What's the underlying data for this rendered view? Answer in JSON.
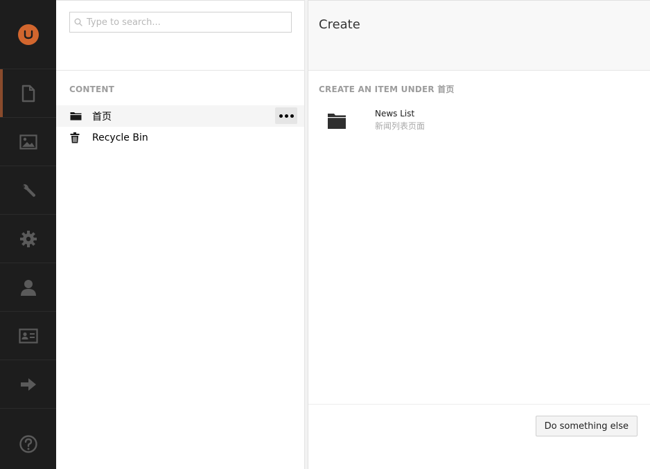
{
  "colors": {
    "appbar_bg": "#1d1d1d",
    "logo": "#d2662e",
    "active_marker": "#8a4b2c",
    "icon_dim": "#5a5a5a"
  },
  "appbar": {
    "logo": "umbraco-logo-icon",
    "sections": [
      {
        "icon": "content-document-icon",
        "active": true
      },
      {
        "icon": "media-image-icon",
        "active": false
      },
      {
        "icon": "settings-wrench-icon",
        "active": false
      },
      {
        "icon": "developer-gear-icon",
        "active": false
      },
      {
        "icon": "users-person-icon",
        "active": false
      },
      {
        "icon": "members-id-card-icon",
        "active": false
      },
      {
        "icon": "forms-arrow-right-icon",
        "active": false
      }
    ],
    "help_icon": "help-circle-icon"
  },
  "tree": {
    "search": {
      "placeholder": "Type to search...",
      "value": ""
    },
    "section_label": "CONTENT",
    "items": [
      {
        "label": "首页",
        "icon": "folder-icon",
        "hovered": true
      },
      {
        "label": "Recycle Bin",
        "icon": "trash-icon",
        "hovered": false
      }
    ]
  },
  "create": {
    "title": "Create",
    "subtitle": "CREATE AN ITEM UNDER 首页",
    "items": [
      {
        "name": "News List",
        "description": "新闻列表页面",
        "icon": "folder-icon"
      }
    ],
    "other_button": "Do something else"
  }
}
